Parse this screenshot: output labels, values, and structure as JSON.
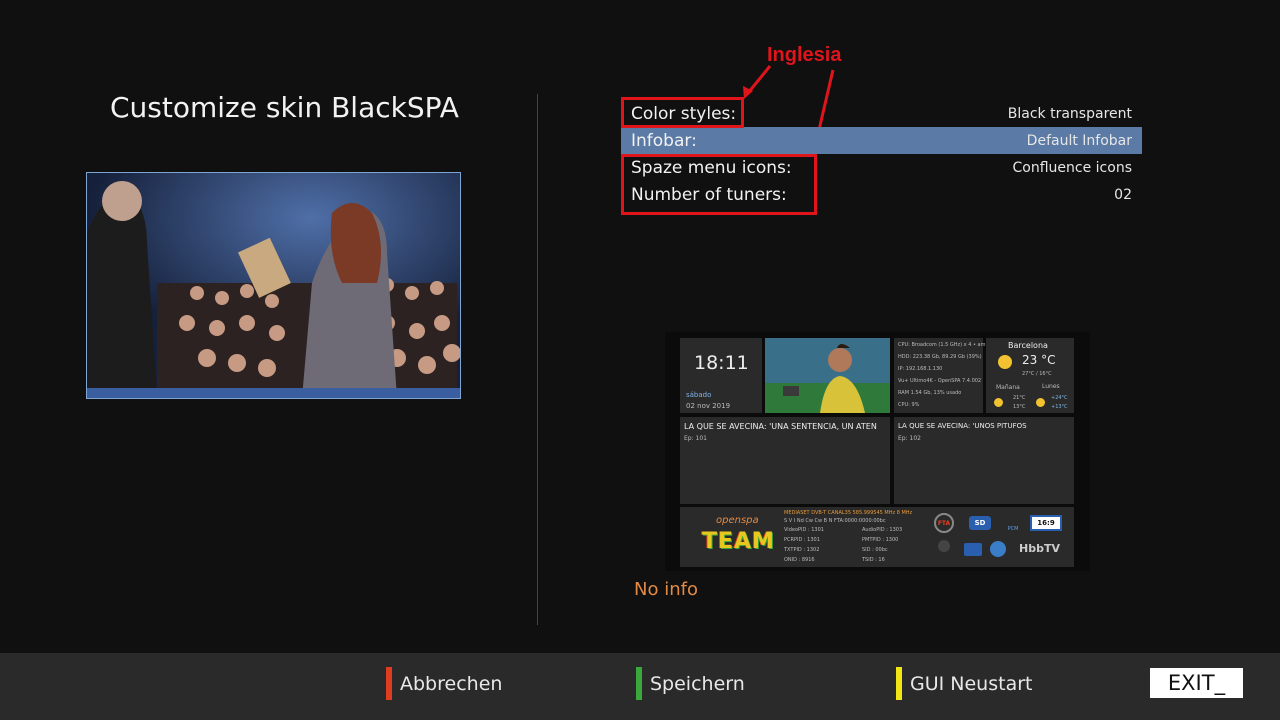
{
  "page_title": "Customize skin BlackSPA",
  "annotation": {
    "text": "Inglesia",
    "color": "#e0141b"
  },
  "menu": [
    {
      "label": "Color styles:",
      "value": "Black transparent",
      "selected": false
    },
    {
      "label": "Infobar:",
      "value": "Default Infobar",
      "selected": true
    },
    {
      "label": "Spaze menu icons:",
      "value": "Confluence icons",
      "selected": false
    },
    {
      "label": "Number of tuners:",
      "value": "02",
      "selected": false
    }
  ],
  "skin_preview": {
    "clock": "18:11",
    "day": "sábado",
    "date": "02 nov 2019",
    "sysinfo": [
      "CPU: Broadcom (1.5 GHz) x 4 • am",
      "HDD: 223.38 Gb, 89.29 Gb (39%)",
      "IP: 192.168.1.130",
      "Vu+ Ultimo4K - OpenSPA 7.4.002",
      "RAM 1.54 Gb, 13% usado",
      "CPU:  9%"
    ],
    "weather": {
      "city": "Barcelona",
      "temp": "23 °C",
      "range": "27°C / 16°C",
      "tomorrow_label": "Mañana",
      "tomorrow_range": [
        "21°C",
        "13°C"
      ],
      "next_label": "Lunes",
      "next_range": [
        "+24°C",
        "+13°C"
      ]
    },
    "epg_now": {
      "title": "LA QUE SE AVECINA: 'UNA SENTENCIA, UN ATEN",
      "ep": "Ep: 101"
    },
    "epg_next": {
      "title": "LA QUE SE AVECINA: 'UNOS PITUFOS",
      "ep": "Ep: 102"
    },
    "channel_line": "MEDIASET  DVB-T  CANAL35  585.999545 MHz  8 MHz",
    "caid_line": "S V I Nd Cw Cw B N   FTA:0000:0000:00bc",
    "pids": {
      "video": "VideoPID :   1301",
      "pcr": "PCRPID :   1301",
      "txt": "TXTPID :   1302",
      "onid": "ONID :   8916",
      "audio": "AudioPID :   1303",
      "pmt": "PMTPID :   1300",
      "sid": "SID :   00bc",
      "tsid": "TSID :   16"
    },
    "logo_text": "openspa",
    "team_text": "TEAM",
    "badges": {
      "fta": "FTA",
      "sd": "SD",
      "pcm": "PCM",
      "ratio": "16:9",
      "hbbtv": "HbbTV"
    }
  },
  "no_info": "No info",
  "buttons": {
    "red": {
      "label": "Abbrechen",
      "color": "#e03c1f"
    },
    "green": {
      "label": "Speichern",
      "color": "#3aa83a"
    },
    "yellow": {
      "label": "GUI Neustart",
      "color": "#f2e516"
    },
    "exit": "EXIT_"
  }
}
